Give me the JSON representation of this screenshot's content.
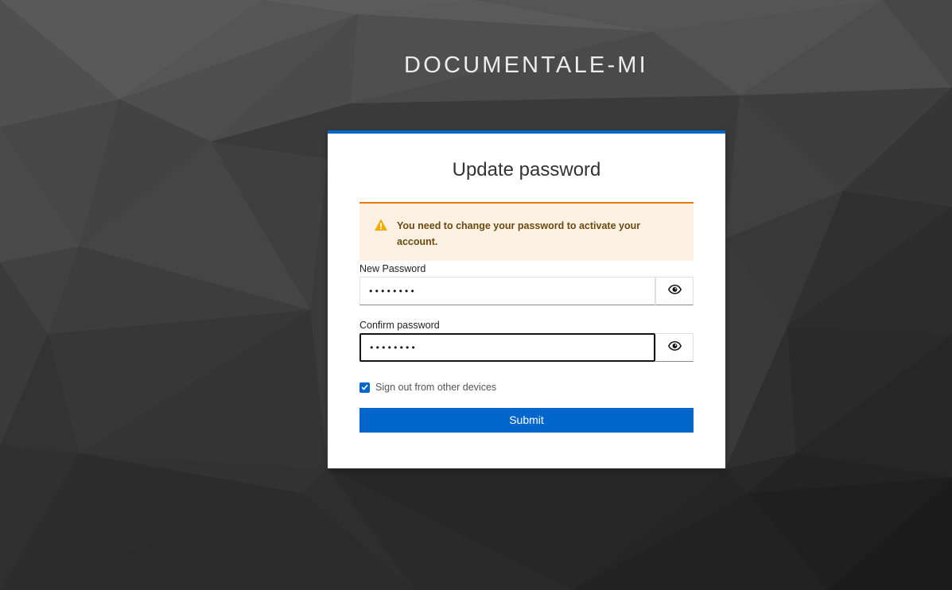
{
  "brand": {
    "title": "DOCUMENTALE-MI"
  },
  "form": {
    "title": "Update password",
    "alert": {
      "icon": "warning-triangle-icon",
      "message": "You need to change your password to activate your account.",
      "color": "#ec7a08"
    },
    "new_password": {
      "label": "New Password",
      "value": "••••••••",
      "toggle_icon": "eye-icon"
    },
    "confirm_password": {
      "label": "Confirm password",
      "value": "••••••••",
      "toggle_icon": "eye-icon",
      "focused": true
    },
    "logout_sessions": {
      "label": "Sign out from other devices",
      "checked": true
    },
    "submit_label": "Submit"
  },
  "colors": {
    "accent": "#0066cc",
    "warning": "#ec7a08",
    "alert_bg": "#fdf1e4"
  }
}
